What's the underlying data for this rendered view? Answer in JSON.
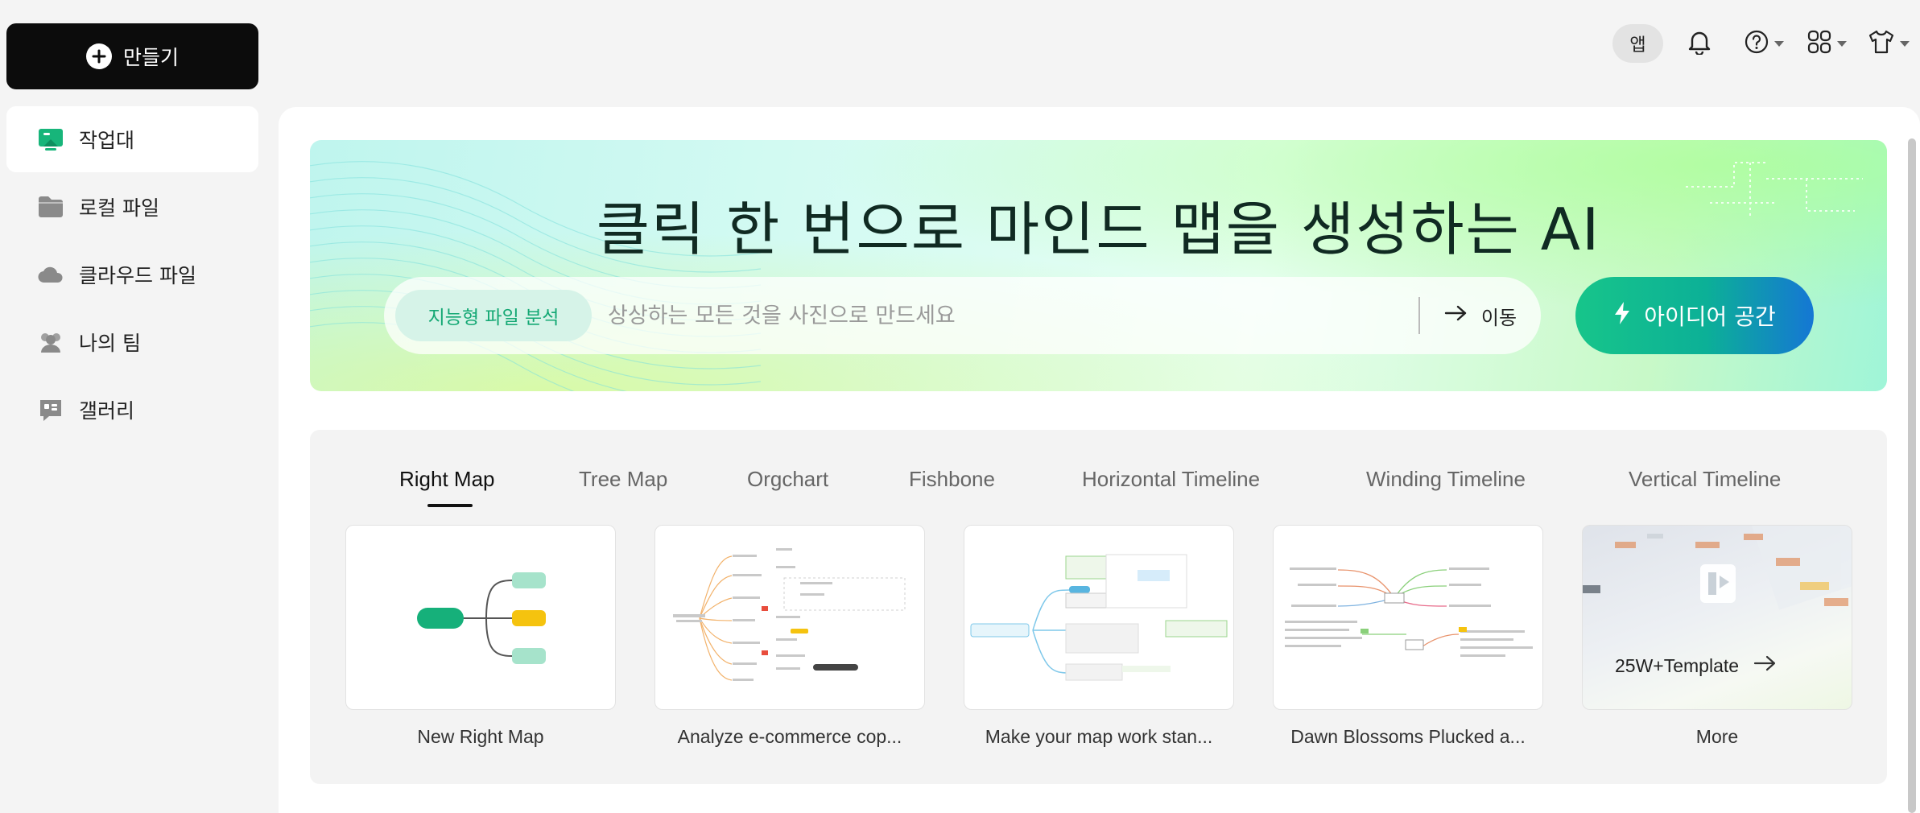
{
  "sidebar": {
    "create_label": "만들기",
    "items": [
      {
        "label": "작업대",
        "icon": "workbench-icon"
      },
      {
        "label": "로컬 파일",
        "icon": "folder-icon"
      },
      {
        "label": "클라우드 파일",
        "icon": "cloud-icon"
      },
      {
        "label": "나의 팀",
        "icon": "team-icon"
      },
      {
        "label": "갤러리",
        "icon": "gallery-icon"
      }
    ]
  },
  "topbar": {
    "app_label": "앱",
    "icons": [
      "bell-icon",
      "help-icon",
      "apps-grid-icon",
      "shirt-icon"
    ]
  },
  "banner": {
    "title": "클릭 한 번으로 마인드 맵을 생성하는 AI",
    "chip_label": "지능형 파일 분석",
    "search_placeholder": "상상하는 모든 것을 사진으로 만드세요",
    "go_label": "이동",
    "idea_label": "아이디어 공간"
  },
  "templates": {
    "tabs": [
      "Right Map",
      "Tree Map",
      "Orgchart",
      "Fishbone",
      "Horizontal Timeline",
      "Winding Timeline",
      "Vertical Timeline"
    ],
    "active_tab": "Right Map",
    "cards": [
      "New Right Map",
      "Analyze e-commerce cop...",
      "Make your map work stan...",
      "Dawn Blossoms Plucked a...",
      "More"
    ],
    "more_card_text": "25W+Template"
  },
  "colors": {
    "accent_green": "#14a874",
    "brand_blue": "#1577d4",
    "node_green": "#16b07a",
    "node_yellow": "#f5c30f",
    "node_mint": "#a6e3cb"
  }
}
